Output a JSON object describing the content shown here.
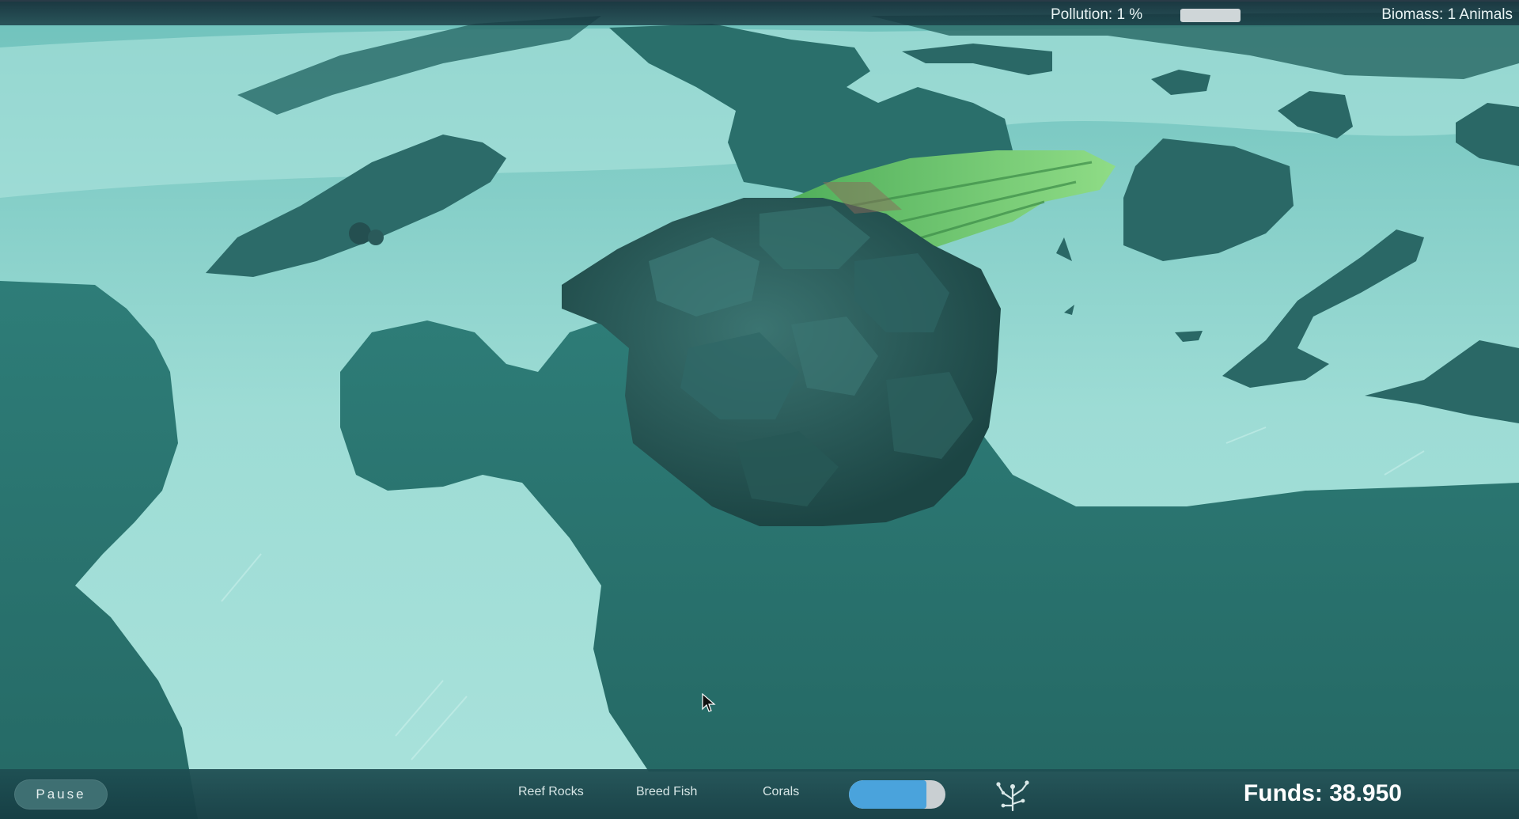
{
  "hud": {
    "pollution_label": "Pollution: 1 %",
    "pollution_level": 1,
    "biomass_label": "Biomass: 1 Animals"
  },
  "toolbar": {
    "pause_label": "Pause",
    "reef_rocks_label": "Reef Rocks",
    "breed_fish_label": "Breed Fish",
    "corals_label": "Corals",
    "toggle_level": 0.8,
    "tree_icon": "tech-tree-icon",
    "funds_label": "Funds: 38.950"
  },
  "colors": {
    "water": "#7fcdc6",
    "water_light": "#bfe9e4",
    "seabed": "#2f7f7a",
    "seabed_dark": "#215e5c",
    "rock": "#2a5a58",
    "seaweed": "#6cc46a",
    "toggle_accent": "#4aa3dc"
  }
}
